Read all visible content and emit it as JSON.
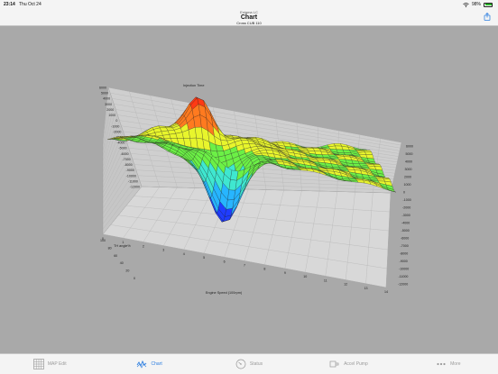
{
  "status": {
    "time": "23:14",
    "date": "Thu Oct 24",
    "battery": "98%"
  },
  "nav": {
    "subtitle": "Enigma LC",
    "title": "Chart",
    "detail": "Cross CUB 110"
  },
  "chart_data": {
    "type": "surface",
    "title": "Injection Time",
    "xlabel": "Engine Speed (100rpm)",
    "ylabel": "TH angle%",
    "x_ticks": [
      "0",
      "1",
      "2",
      "3",
      "4",
      "5",
      "6",
      "7",
      "8",
      "9",
      "10",
      "11",
      "12",
      "13",
      "14"
    ],
    "y_ticks": [
      "0",
      "20",
      "40",
      "60",
      "80",
      "100"
    ],
    "z_ticks_left": [
      "6000",
      "5000",
      "4000",
      "3000",
      "2000",
      "1000",
      "0",
      "-1000",
      "-2000",
      "-3000",
      "-4000",
      "-5000",
      "-6000",
      "-7000",
      "-8000",
      "-9000",
      "-10000",
      "-11000",
      "-12000"
    ],
    "z_ticks_right": [
      "6000",
      "5000",
      "4000",
      "3000",
      "2000",
      "1000",
      "0",
      "-1000",
      "-2000",
      "-3000",
      "-4000",
      "-5000",
      "-6000",
      "-7000",
      "-8000",
      "-9000",
      "-10000",
      "-11000",
      "-12000"
    ],
    "z_range": [
      -12000,
      6000
    ],
    "colors": [
      "#1f3cff",
      "#27b5ff",
      "#3fe7d0",
      "#6cf046",
      "#e8f52c",
      "#ff7a1f",
      "#ff3a14"
    ]
  },
  "tabs": [
    {
      "label": "MAP Edit",
      "icon": "grid-icon",
      "active": false
    },
    {
      "label": "Chart",
      "icon": "chart-icon",
      "active": true
    },
    {
      "label": "Status",
      "icon": "gauge-icon",
      "active": false
    },
    {
      "label": "Accel Pump",
      "icon": "pump-icon",
      "active": false
    },
    {
      "label": "More",
      "icon": "more-icon",
      "active": false
    }
  ]
}
